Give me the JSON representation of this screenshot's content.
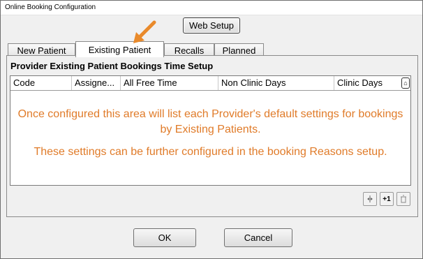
{
  "window": {
    "title": "Online Booking Configuration"
  },
  "toolbar": {
    "web_setup_label": "Web Setup"
  },
  "tabs": [
    {
      "label": "New Patient"
    },
    {
      "label": "Existing Patient"
    },
    {
      "label": "Recalls"
    },
    {
      "label": "Planned"
    }
  ],
  "panel": {
    "title": "Provider Existing Patient Bookings Time Setup",
    "columns": [
      {
        "label": "Code"
      },
      {
        "label": "Assigne..."
      },
      {
        "label": "All Free Time"
      },
      {
        "label": "Non Clinic Days"
      },
      {
        "label": "Clinic Days"
      }
    ],
    "message_line1": "Once configured this area will list each Provider's default settings for bookings by Existing Patients.",
    "message_line2": "These settings can be further configured in the booking Reasons setup.",
    "message_color": "#e07b29"
  },
  "grid_actions": [
    {
      "icon": "split-icon",
      "label": ""
    },
    {
      "icon": "plus-one-icon",
      "label": "+1"
    },
    {
      "icon": "trash-icon",
      "label": ""
    }
  ],
  "footer": {
    "ok_label": "OK",
    "cancel_label": "Cancel"
  },
  "annotation": {
    "arrow_color": "#e98a2b"
  }
}
